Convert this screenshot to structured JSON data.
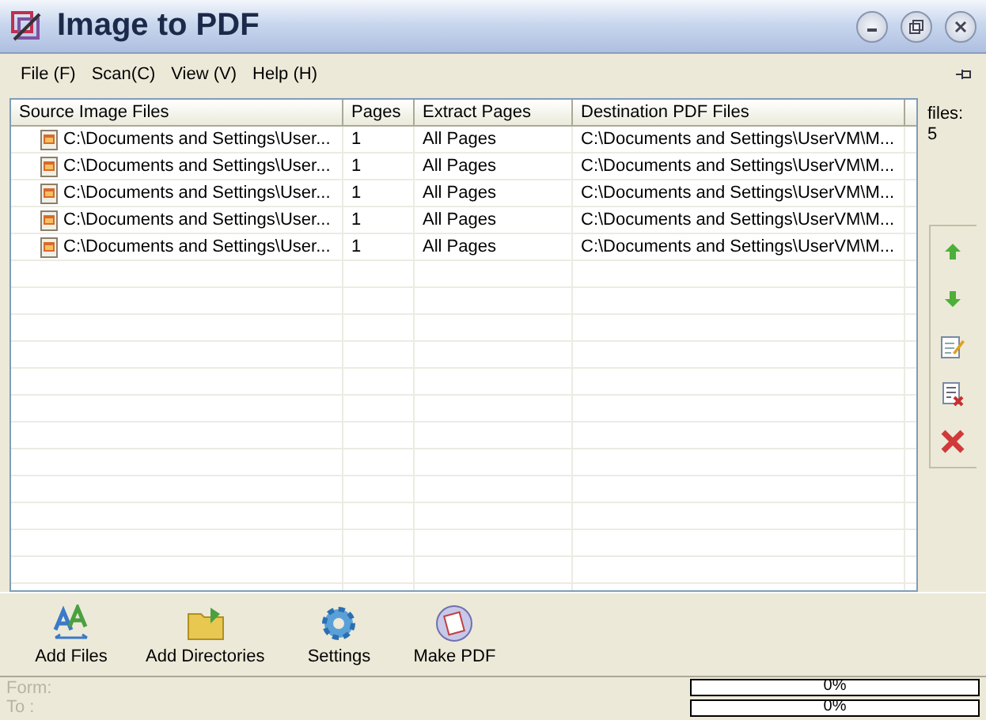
{
  "window": {
    "title": "Image to PDF"
  },
  "menu": [
    "File (F)",
    "Scan(C)",
    "View (V)",
    "Help (H)"
  ],
  "table": {
    "columns": [
      "Source Image Files",
      "Pages",
      "Extract Pages",
      "Destination PDF Files"
    ],
    "rows": [
      [
        "C:\\Documents and Settings\\User...",
        "1",
        "All Pages",
        "C:\\Documents and Settings\\UserVM\\M..."
      ],
      [
        "C:\\Documents and Settings\\User...",
        "1",
        "All Pages",
        "C:\\Documents and Settings\\UserVM\\M..."
      ],
      [
        "C:\\Documents and Settings\\User...",
        "1",
        "All Pages",
        "C:\\Documents and Settings\\UserVM\\M..."
      ],
      [
        "C:\\Documents and Settings\\User...",
        "1",
        "All Pages",
        "C:\\Documents and Settings\\UserVM\\M..."
      ],
      [
        "C:\\Documents and Settings\\User...",
        "1",
        "All Pages",
        "C:\\Documents and Settings\\UserVM\\M..."
      ]
    ]
  },
  "files_count": {
    "label": "files:",
    "value": "5"
  },
  "side_tools": [
    {
      "kind": "up"
    },
    {
      "kind": "down"
    },
    {
      "kind": "edit"
    },
    {
      "kind": "remove"
    },
    {
      "kind": "clear"
    }
  ],
  "toolbar": [
    {
      "kind": "add-files",
      "label": "Add Files"
    },
    {
      "kind": "add-dirs",
      "label": "Add Directories"
    },
    {
      "kind": "settings",
      "label": "Settings"
    },
    {
      "kind": "make-pdf",
      "label": "Make PDF"
    }
  ],
  "status": {
    "from_label": "Form:",
    "to_label": "To :",
    "progress": [
      {
        "level": 0,
        "reading": "0%"
      },
      {
        "level": 0,
        "reading": "0%"
      }
    ]
  }
}
